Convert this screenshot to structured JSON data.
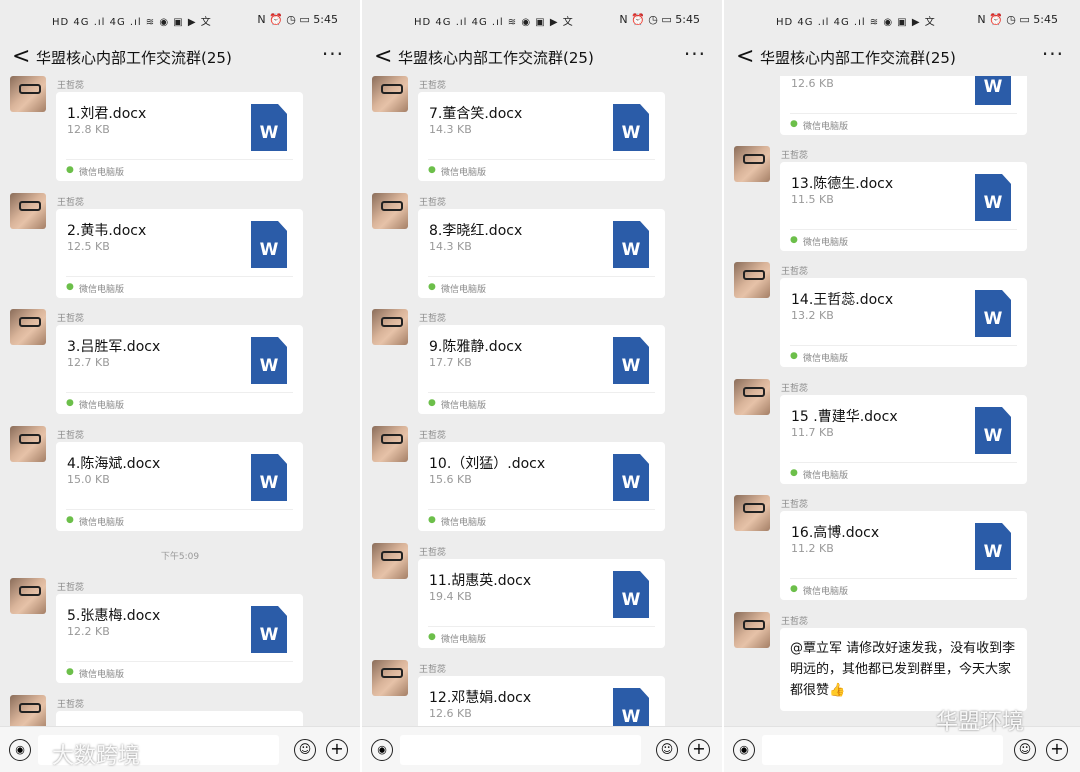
{
  "status": {
    "left_icons": "HD 4G .ıl 4G .ıl ≋ ◉ ▣ ▶ 文",
    "right_icons": "N ⏰ ◷ ▭",
    "time": "5:45"
  },
  "header": {
    "back_glyph": "<",
    "title": "华盟核心内部工作交流群(25)",
    "more_glyph": "···"
  },
  "sender_name": "王哲蕊",
  "source_label": "微信电脑版",
  "doc_icon_letter": "W",
  "panel1": {
    "files": [
      {
        "name": "1.刘君.docx",
        "size": "12.8 KB"
      },
      {
        "name": "2.黄韦.docx",
        "size": "12.5 KB"
      },
      {
        "name": "3.吕胜军.docx",
        "size": "12.7 KB"
      },
      {
        "name": "4.陈海斌.docx",
        "size": "15.0 KB"
      },
      {
        "name": "5.张惠梅.docx",
        "size": "12.2 KB"
      }
    ],
    "time_label": "下午5:09"
  },
  "panel2": {
    "files": [
      {
        "name": "7.董含笑.docx",
        "size": "14.3 KB"
      },
      {
        "name": "8.李晓红.docx",
        "size": "14.3 KB"
      },
      {
        "name": "9.陈雅静.docx",
        "size": "17.7 KB"
      },
      {
        "name": "10.（刘猛）.docx",
        "size": "15.6 KB"
      },
      {
        "name": "11.胡惠英.docx",
        "size": "19.4 KB"
      },
      {
        "name": "12.邓慧娟.docx",
        "size": "12.6 KB"
      }
    ]
  },
  "panel3": {
    "partial_size": "12.6 KB",
    "files": [
      {
        "name": "13.陈德生.docx",
        "size": "11.5 KB"
      },
      {
        "name": "14.王哲蕊.docx",
        "size": "13.2 KB"
      },
      {
        "name": "15 .曹建华.docx",
        "size": "11.7 KB"
      },
      {
        "name": "16.高博.docx",
        "size": "11.2 KB"
      }
    ],
    "text_message": "@覃立军 请修改好速发我，没有收到李明远的，其他都已发到群里，今天大家都很赞👍"
  },
  "bottombar": {
    "voice_glyph": "◉",
    "emoji_glyph": "☺",
    "plus_glyph": "+"
  },
  "watermarks": {
    "left": "大数跨境",
    "right": "华盟环境"
  }
}
